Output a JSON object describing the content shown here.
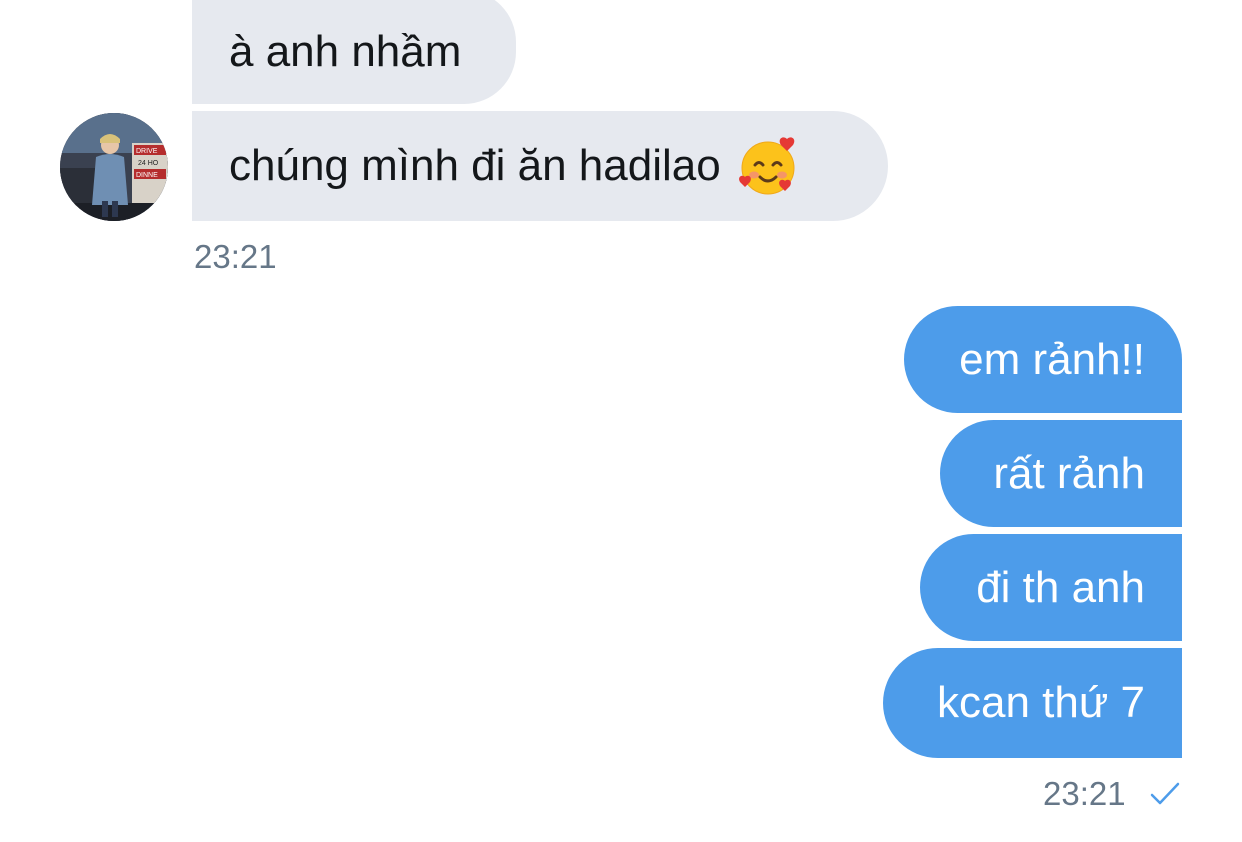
{
  "chat": {
    "incoming": [
      {
        "text": "à anh nhầm"
      },
      {
        "text": "chúng mình đi ăn hadilao",
        "emoji": "smiling-face-with-hearts"
      }
    ],
    "incoming_time": "23:21",
    "outgoing": [
      {
        "text": "em rảnh!!"
      },
      {
        "text": "rất rảnh"
      },
      {
        "text": "đi th anh"
      },
      {
        "text": "kcan thứ 7"
      }
    ],
    "outgoing_time": "23:21",
    "read_status_icon": "checkmark-icon"
  },
  "colors": {
    "incoming_bubble": "#e6e9ef",
    "outgoing_bubble": "#4d9cea",
    "timestamp": "#667788",
    "check": "#4d9cea"
  }
}
